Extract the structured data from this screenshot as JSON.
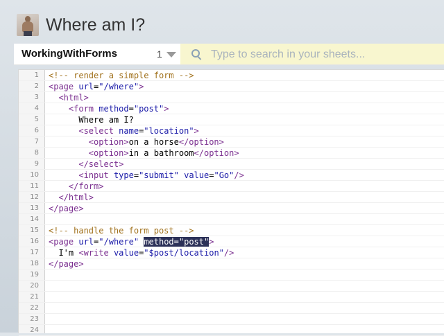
{
  "header": {
    "title": "Where am I?"
  },
  "toolbar": {
    "sheet_name": "WorkingWithForms",
    "sheet_count": "1",
    "search_placeholder": "Type to search in your sheets..."
  },
  "editor": {
    "lines": [
      {
        "n": "1",
        "tokens": [
          {
            "c": "cm",
            "t": "<!-- render a simple form -->"
          }
        ]
      },
      {
        "n": "2",
        "tokens": [
          {
            "c": "tg",
            "t": "<page "
          },
          {
            "c": "at",
            "t": "url"
          },
          {
            "c": "",
            "t": "="
          },
          {
            "c": "st",
            "t": "\"/where\""
          },
          {
            "c": "tg",
            "t": ">"
          }
        ]
      },
      {
        "n": "3",
        "tokens": [
          {
            "c": "",
            "t": "  "
          },
          {
            "c": "tg",
            "t": "<html>"
          }
        ]
      },
      {
        "n": "4",
        "tokens": [
          {
            "c": "",
            "t": "    "
          },
          {
            "c": "tg",
            "t": "<form "
          },
          {
            "c": "at",
            "t": "method"
          },
          {
            "c": "",
            "t": "="
          },
          {
            "c": "st",
            "t": "\"post\""
          },
          {
            "c": "tg",
            "t": ">"
          }
        ]
      },
      {
        "n": "5",
        "tokens": [
          {
            "c": "",
            "t": "      Where am I?"
          }
        ]
      },
      {
        "n": "6",
        "tokens": [
          {
            "c": "",
            "t": "      "
          },
          {
            "c": "tg",
            "t": "<select "
          },
          {
            "c": "at",
            "t": "name"
          },
          {
            "c": "",
            "t": "="
          },
          {
            "c": "st",
            "t": "\"location\""
          },
          {
            "c": "tg",
            "t": ">"
          }
        ]
      },
      {
        "n": "7",
        "tokens": [
          {
            "c": "",
            "t": "        "
          },
          {
            "c": "tg",
            "t": "<option>"
          },
          {
            "c": "",
            "t": "on a horse"
          },
          {
            "c": "tg",
            "t": "</option>"
          }
        ]
      },
      {
        "n": "8",
        "tokens": [
          {
            "c": "",
            "t": "        "
          },
          {
            "c": "tg",
            "t": "<option>"
          },
          {
            "c": "",
            "t": "in a bathroom"
          },
          {
            "c": "tg",
            "t": "</option>"
          }
        ]
      },
      {
        "n": "9",
        "tokens": [
          {
            "c": "",
            "t": "      "
          },
          {
            "c": "tg",
            "t": "</select>"
          }
        ]
      },
      {
        "n": "10",
        "tokens": [
          {
            "c": "",
            "t": "      "
          },
          {
            "c": "tg",
            "t": "<input "
          },
          {
            "c": "at",
            "t": "type"
          },
          {
            "c": "",
            "t": "="
          },
          {
            "c": "st",
            "t": "\"submit\""
          },
          {
            "c": "",
            "t": " "
          },
          {
            "c": "at",
            "t": "value"
          },
          {
            "c": "",
            "t": "="
          },
          {
            "c": "st",
            "t": "\"Go\""
          },
          {
            "c": "tg",
            "t": "/>"
          }
        ]
      },
      {
        "n": "11",
        "tokens": [
          {
            "c": "",
            "t": "    "
          },
          {
            "c": "tg",
            "t": "</form>"
          }
        ]
      },
      {
        "n": "12",
        "tokens": [
          {
            "c": "",
            "t": "  "
          },
          {
            "c": "tg",
            "t": "</html>"
          }
        ]
      },
      {
        "n": "13",
        "tokens": [
          {
            "c": "tg",
            "t": "</page>"
          }
        ]
      },
      {
        "n": "14",
        "tokens": []
      },
      {
        "n": "15",
        "tokens": [
          {
            "c": "cm",
            "t": "<!-- handle the form post -->"
          }
        ]
      },
      {
        "n": "16",
        "tokens": [
          {
            "c": "tg",
            "t": "<page "
          },
          {
            "c": "at",
            "t": "url"
          },
          {
            "c": "",
            "t": "="
          },
          {
            "c": "st",
            "t": "\"/where\""
          },
          {
            "c": "",
            "t": " "
          },
          {
            "c": "sel",
            "t": "method=\"post\""
          },
          {
            "c": "tg",
            "t": ">"
          }
        ]
      },
      {
        "n": "17",
        "tokens": [
          {
            "c": "",
            "t": "  I'm "
          },
          {
            "c": "tg",
            "t": "<write "
          },
          {
            "c": "at",
            "t": "value"
          },
          {
            "c": "",
            "t": "="
          },
          {
            "c": "st",
            "t": "\"$post/location\""
          },
          {
            "c": "tg",
            "t": "/>"
          }
        ]
      },
      {
        "n": "18",
        "tokens": [
          {
            "c": "tg",
            "t": "</page>"
          }
        ]
      },
      {
        "n": "19",
        "tokens": []
      },
      {
        "n": "20",
        "tokens": []
      },
      {
        "n": "21",
        "tokens": []
      },
      {
        "n": "22",
        "tokens": []
      },
      {
        "n": "23",
        "tokens": []
      },
      {
        "n": "24",
        "tokens": []
      }
    ]
  },
  "colors": {
    "comment": "#a0701a",
    "tag": "#7a2e8f",
    "attr": "#1a1aa8",
    "selection": "#2c3158",
    "search_bg": "#f8f6cf"
  },
  "icons": {
    "avatar": "avatar",
    "search": "search-icon",
    "dropdown": "chevron-down-icon"
  }
}
